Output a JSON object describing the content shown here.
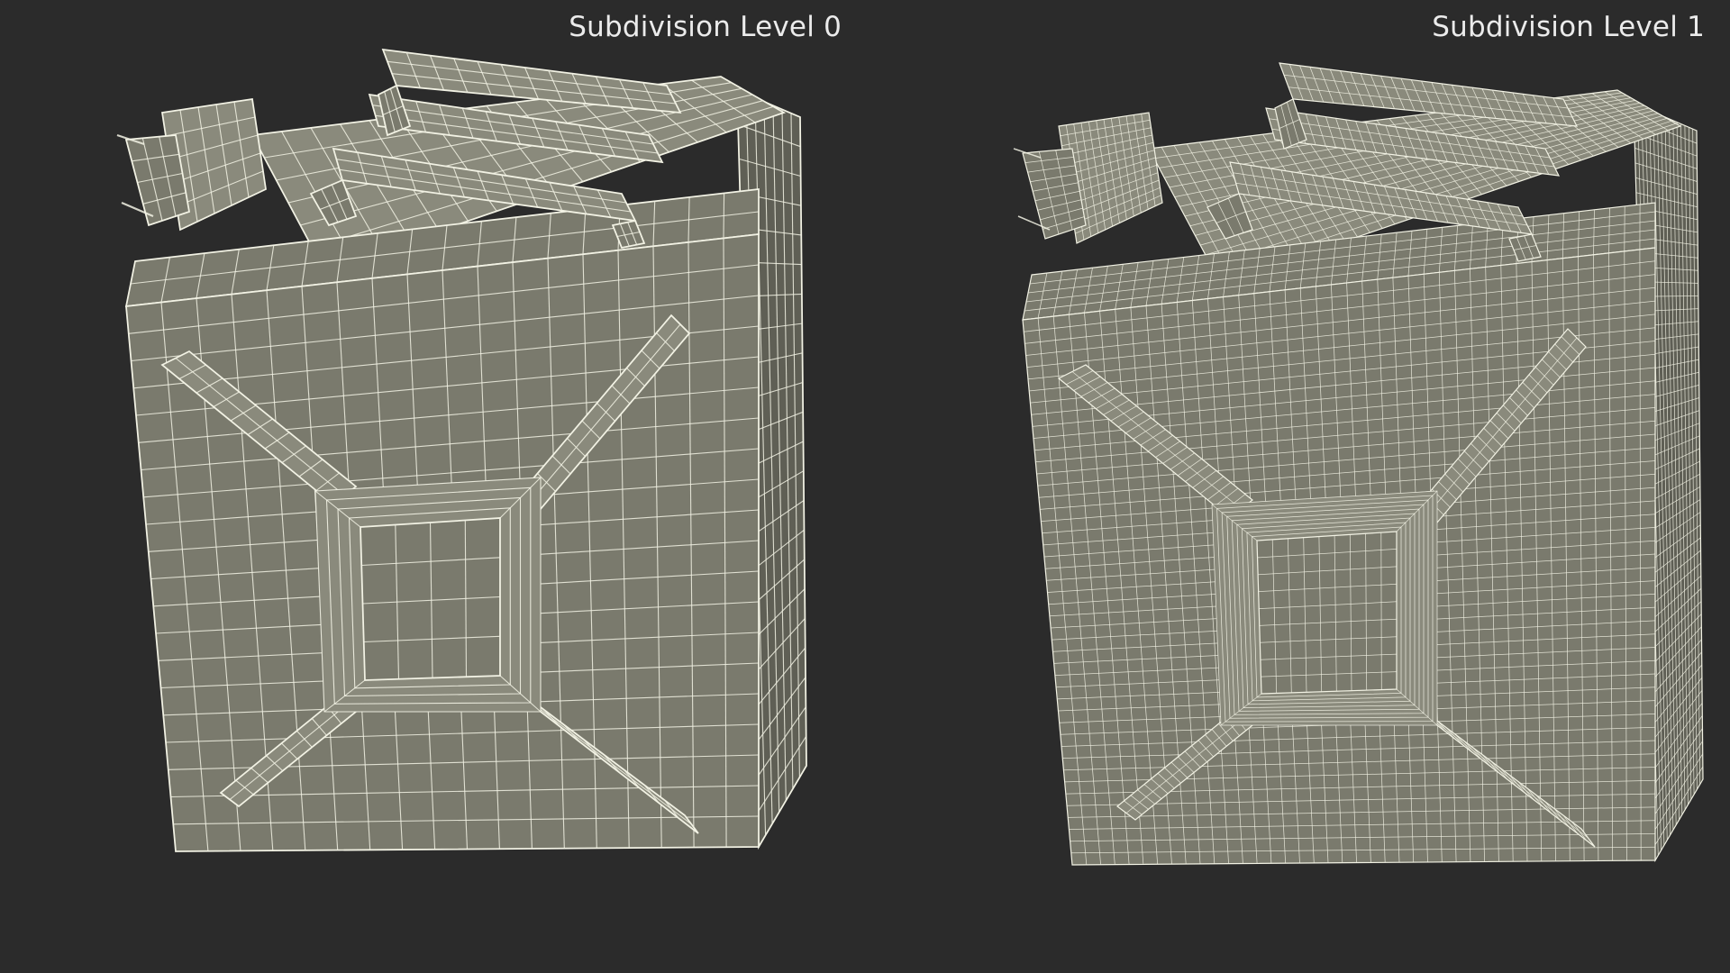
{
  "viewports": [
    {
      "label": "Subdivision Level 0",
      "level": 0
    },
    {
      "label": "Subdivision Level 1",
      "level": 1
    }
  ],
  "colors": {
    "background": "#2b2b2b",
    "surface": "#7a7a6d",
    "surface_dark": "#5f5f55",
    "surface_light": "#8a8a7c",
    "wire": "#f2f2e4",
    "label": "#ebebeb"
  }
}
